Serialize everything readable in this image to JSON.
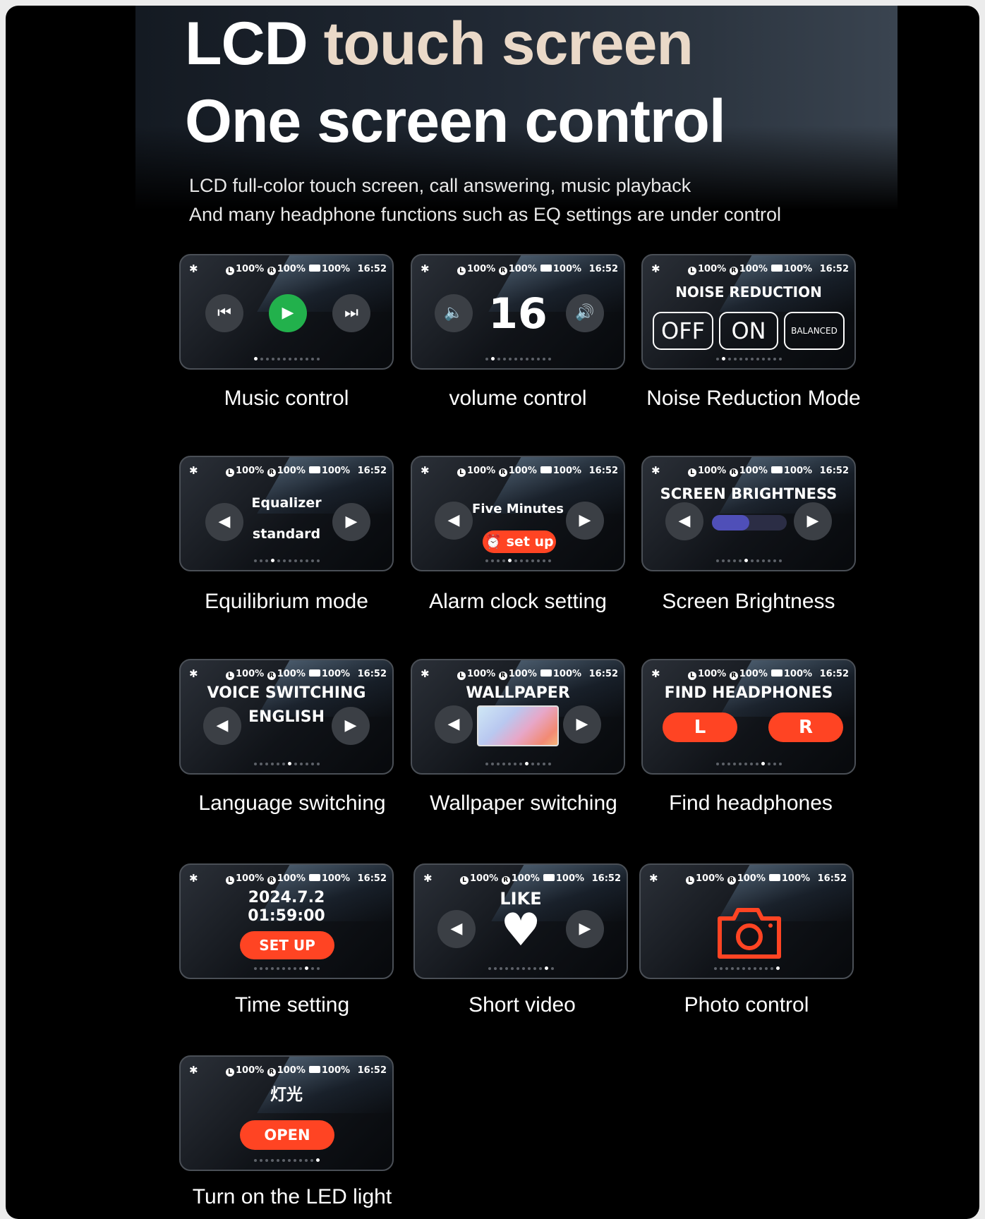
{
  "header": {
    "title_line1_a": "LCD",
    "title_line1_b": "touch screen",
    "title_line2": "One screen control",
    "sub1": "LCD full-color touch screen, call answering, music playback",
    "sub2": "And many headphone functions such as EQ settings are under control"
  },
  "status": {
    "left": "L",
    "right": "R",
    "pct": "100%",
    "time": "16:52",
    "bt_icon": "bluetooth-icon"
  },
  "cards": {
    "music": {
      "caption": "Music control"
    },
    "volume": {
      "caption": "volume control",
      "value": "16"
    },
    "noise": {
      "caption": "Noise Reduction Mode",
      "title": "NOISE REDUCTION",
      "off": "OFF",
      "on": "ON",
      "balanced": "BALANCED"
    },
    "eq": {
      "caption": "Equilibrium mode",
      "title": "Equalizer",
      "mode": "standard"
    },
    "alarm": {
      "caption": "Alarm clock setting",
      "label": "Five Minutes",
      "button": "set up"
    },
    "brightness": {
      "caption": "Screen Brightness",
      "title": "SCREEN BRIGHTNESS",
      "level": 0.5
    },
    "language": {
      "caption": "Language switching",
      "title": "VOICE SWITCHING",
      "value": "ENGLISH"
    },
    "wallpaper": {
      "caption": "Wallpaper switching",
      "title": "WALLPAPER"
    },
    "find": {
      "caption": "Find headphones",
      "title": "FIND HEADPHONES",
      "left": "L",
      "right": "R"
    },
    "time": {
      "caption": "Time setting",
      "date": "2024.7.2",
      "clock": "01:59:00",
      "button": "SET UP"
    },
    "video": {
      "caption": "Short video",
      "title": "LIKE"
    },
    "photo": {
      "caption": "Photo control"
    },
    "light": {
      "caption": "Turn on the LED light",
      "title": "灯光",
      "button": "OPEN"
    }
  },
  "colors": {
    "accent_red": "#ff4423",
    "play_green": "#22b14c",
    "brightness_bar": "#4f4fb8",
    "title_peach": "#ead9c8"
  }
}
